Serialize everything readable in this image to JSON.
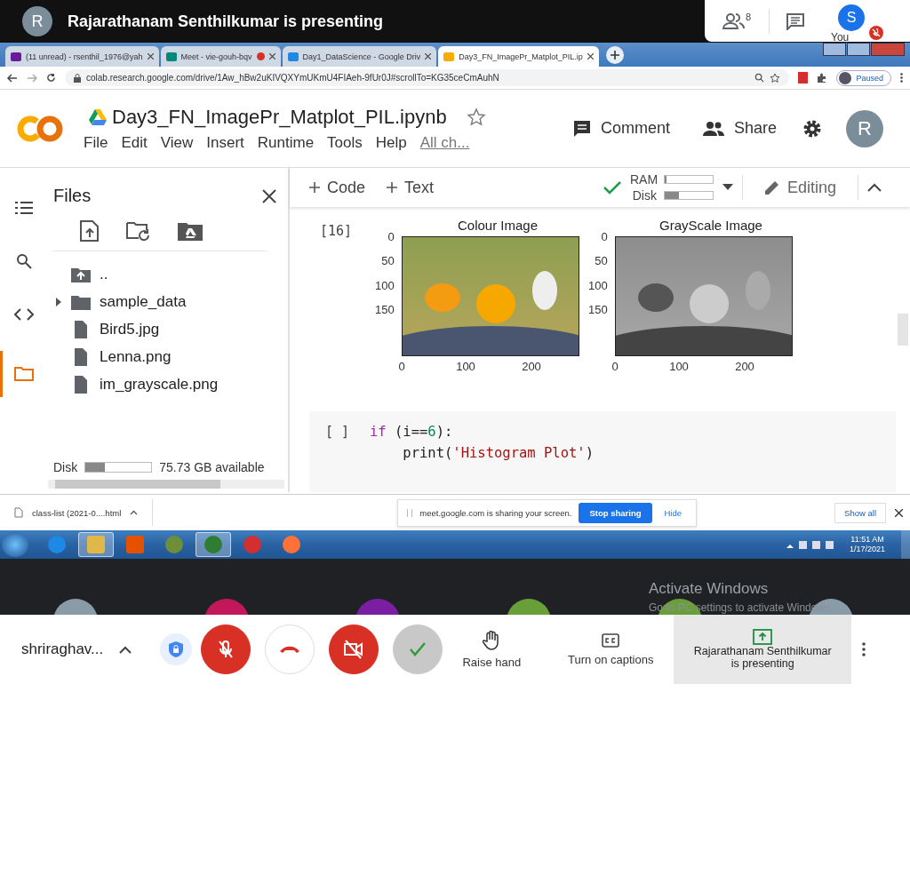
{
  "meet_header": {
    "presenter_initial": "R",
    "title": "Rajarathanam Senthilkumar is presenting",
    "participant_count": "8",
    "self_initial": "S",
    "self_label": "You",
    "self_muted": true
  },
  "browser": {
    "tabs": [
      {
        "kind": "mail",
        "title": "(11 unread) - rsenthil_1976@yah",
        "recording": false,
        "selected": false
      },
      {
        "kind": "meet",
        "title": "Meet - vie-gouh-bqv",
        "recording": true,
        "selected": false
      },
      {
        "kind": "drive",
        "title": "Day1_DataScience - Google Driv",
        "recording": false,
        "selected": false
      },
      {
        "kind": "colab",
        "title": "Day3_FN_ImagePr_Matplot_PIL.ip",
        "recording": false,
        "selected": true
      }
    ],
    "url": "colab.research.google.com/drive/1Aw_hBw2uKIVQXYmUKmU4FIAeh-9fUr0J#scrollTo=KG35ceCmAuhN",
    "profile_status": "Paused"
  },
  "colab": {
    "title": "Day3_FN_ImagePr_Matplot_PIL.ipynb",
    "starred": false,
    "menu": [
      "File",
      "Edit",
      "View",
      "Insert",
      "Runtime",
      "Tools",
      "Help"
    ],
    "changes_link": "All ch...",
    "comment": "Comment",
    "share": "Share",
    "avatar": "R",
    "toolbar": {
      "add_code": "Code",
      "add_text": "Text",
      "connected": true,
      "ram": {
        "label": "RAM",
        "level": 0.03
      },
      "disk": {
        "label": "Disk",
        "level": 0.3
      },
      "mode": "Editing"
    },
    "rail": [
      {
        "kind": "toc",
        "selected": false
      },
      {
        "kind": "search",
        "selected": false
      },
      {
        "kind": "code",
        "selected": false
      },
      {
        "kind": "files",
        "selected": true
      }
    ],
    "files": {
      "title": "Files",
      "entries": [
        {
          "kind": "parent",
          "name": ".."
        },
        {
          "kind": "folder",
          "name": "sample_data",
          "expanded": false
        },
        {
          "kind": "file",
          "name": "Bird5.jpg"
        },
        {
          "kind": "file",
          "name": "Lenna.png"
        },
        {
          "kind": "file",
          "name": "im_grayscale.png"
        }
      ],
      "disk": {
        "label": "Disk",
        "level": 0.3,
        "text": "75.73 GB available"
      }
    },
    "cells": [
      {
        "kind": "output",
        "prompt": "[16]",
        "plots": [
          {
            "kind": "colour",
            "title": "Colour Image",
            "yticks": [
              "0",
              "50",
              "100",
              "150"
            ],
            "xticks": [
              "0",
              "100",
              "200"
            ]
          },
          {
            "kind": "gray",
            "title": "GrayScale Image",
            "yticks": [
              "0",
              "50",
              "100",
              "150"
            ],
            "xticks": [
              "0",
              "100",
              "200"
            ]
          }
        ]
      },
      {
        "kind": "code",
        "prompt": "[ ]",
        "lines": [
          [
            {
              "kind": "keyword",
              "t": "if"
            },
            {
              "kind": "plain",
              "t": " (i=="
            },
            {
              "kind": "number",
              "t": "6"
            },
            {
              "kind": "plain",
              "t": "):"
            }
          ],
          [
            {
              "kind": "plain",
              "t": "    print("
            },
            {
              "kind": "string",
              "t": "'Histogram Plot'"
            },
            {
              "kind": "plain",
              "t": ")"
            }
          ]
        ]
      }
    ]
  },
  "downloads": {
    "file": "class-list (2021-0....html",
    "share_notice": "meet.google.com is sharing your screen.",
    "stop_sharing": "Stop sharing",
    "hide": "Hide",
    "show_all": "Show all"
  },
  "taskbar": {
    "apps": [
      {
        "kind": "ie",
        "selected": false
      },
      {
        "kind": "explorer",
        "selected": true
      },
      {
        "kind": "media",
        "selected": false
      },
      {
        "kind": "network",
        "selected": false
      },
      {
        "kind": "chrome",
        "selected": true
      },
      {
        "kind": "opera",
        "selected": false
      },
      {
        "kind": "firefox",
        "selected": false
      }
    ],
    "clock_time": "11:51 AM",
    "clock_date": "1/17/2021"
  },
  "os_overlay": {
    "title": "Activate Windows",
    "hint": "Go to PC settings to activate Windows."
  },
  "meet_bar": {
    "participants": [
      {
        "color": "#8a9ba8"
      },
      {
        "color": "#c2185b"
      },
      {
        "color": "#7b1fa2"
      },
      {
        "color": "#689f38"
      },
      {
        "color": "#689f38"
      },
      {
        "color": "#8a9ba8"
      }
    ],
    "self_name": "shriraghav...",
    "mic_muted": true,
    "camera_off": true,
    "raise_hand": "Raise hand",
    "captions": "Turn on captions",
    "presenter": "Rajarathanam Senthilkumar",
    "presenter_suffix": "is presenting"
  }
}
